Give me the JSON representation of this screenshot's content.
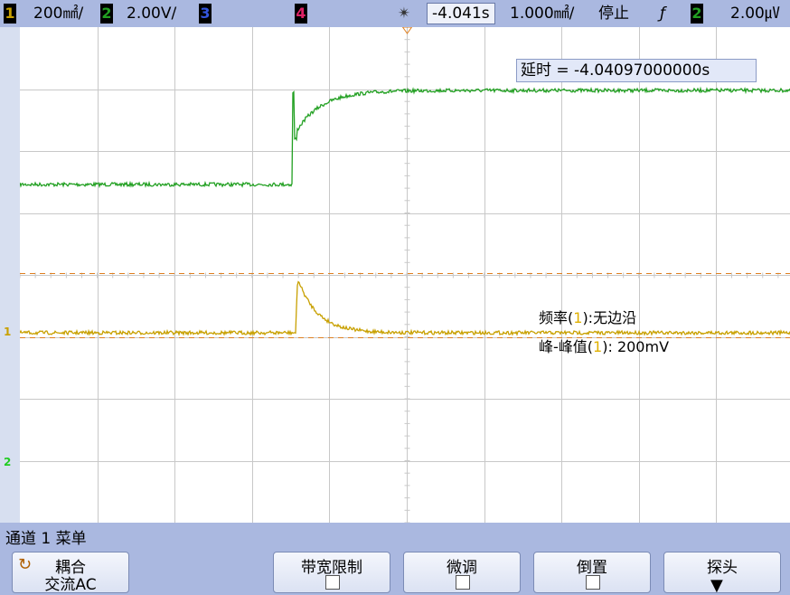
{
  "top": {
    "ch1_num": "1",
    "ch1_scale": "200㎟/",
    "ch2_num": "2",
    "ch2_scale": "2.00V/",
    "ch3_num": "3",
    "ch4_num": "4",
    "run_icon": "✴",
    "time_offset": "-4.041s",
    "timebase": "1.000㎟/",
    "status": "停止",
    "trig_slope": "ƒ",
    "trig_source": "2",
    "trig_level": "2.00㎶"
  },
  "measurements": {
    "delay": "延时 = -4.04097000000s",
    "frequency": "频率(1):无边沿",
    "freq_prefix": "频率(",
    "freq_ch": "1",
    "freq_suffix": "):无边沿",
    "pk_prefix": "峰-峰值(",
    "pk_ch": "1",
    "pk_suffix": "): 200mV"
  },
  "markers": {
    "ch1_ground": "1",
    "ch2_ground": "2"
  },
  "menu": {
    "title": "通道 1  菜单",
    "coupling_label": "耦合",
    "coupling_value": "交流AC",
    "bw_limit": "带宽限制",
    "fine": "微调",
    "invert": "倒置",
    "probe": "探头"
  },
  "colors": {
    "ch1": "#c8a000",
    "ch2": "#22a022",
    "ch3": "#3355dd",
    "ch4": "#dd2266",
    "trigger_marker": "#e08020"
  }
}
